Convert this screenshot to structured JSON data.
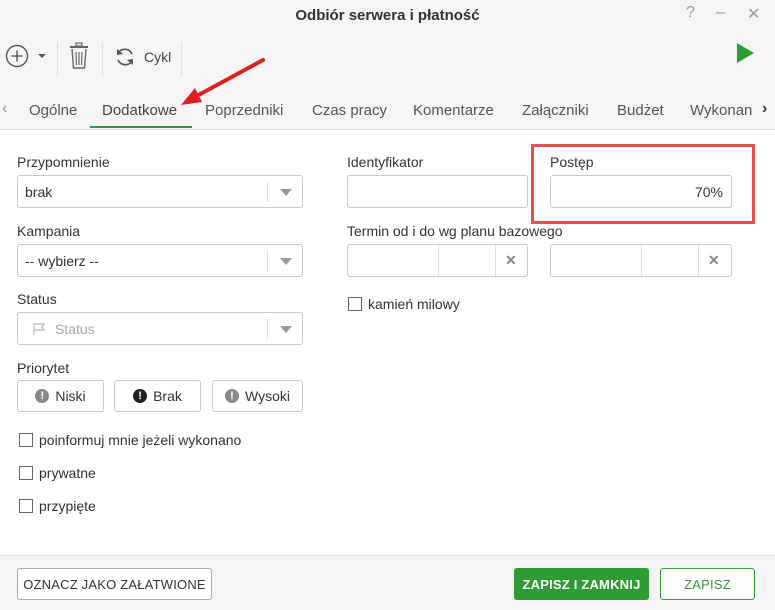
{
  "window": {
    "title": "Odbiór serwera i płatność",
    "help": "?",
    "minimize": "–",
    "close": "✕"
  },
  "toolbar": {
    "cycle_label": "Cykl"
  },
  "tabs": [
    {
      "label": "Ogólne"
    },
    {
      "label": "Dodatkowe"
    },
    {
      "label": "Poprzedniki"
    },
    {
      "label": "Czas pracy"
    },
    {
      "label": "Komentarze"
    },
    {
      "label": "Załączniki"
    },
    {
      "label": "Budżet"
    },
    {
      "label": "Wykonan"
    }
  ],
  "form": {
    "reminder": {
      "label": "Przypomnienie",
      "value": "brak"
    },
    "campaign": {
      "label": "Kampania",
      "value": "-- wybierz --"
    },
    "status": {
      "label": "Status",
      "placeholder": "Status"
    },
    "priority": {
      "label": "Priorytet",
      "low": "Niski",
      "none": "Brak",
      "high": "Wysoki"
    },
    "identifier": {
      "label": "Identyfikator",
      "value": ""
    },
    "progress": {
      "label": "Postęp",
      "value": "70%"
    },
    "term": {
      "label": "Termin od i do wg planu bazowego"
    },
    "milestone": {
      "label": "kamień milowy",
      "checked": false
    },
    "notify": {
      "label": "poinformuj mnie jeżeli wykonano",
      "checked": false
    },
    "private": {
      "label": "prywatne",
      "checked": false
    },
    "pinned": {
      "label": "przypięte",
      "checked": false
    }
  },
  "footer": {
    "mark_done": "OZNACZ JAKO ZAŁATWIONE",
    "save_close": "ZAPISZ I ZAMKNIJ",
    "save": "ZAPISZ"
  },
  "colors": {
    "accent_green": "#2e9b35",
    "annotation_red": "#e35050"
  }
}
